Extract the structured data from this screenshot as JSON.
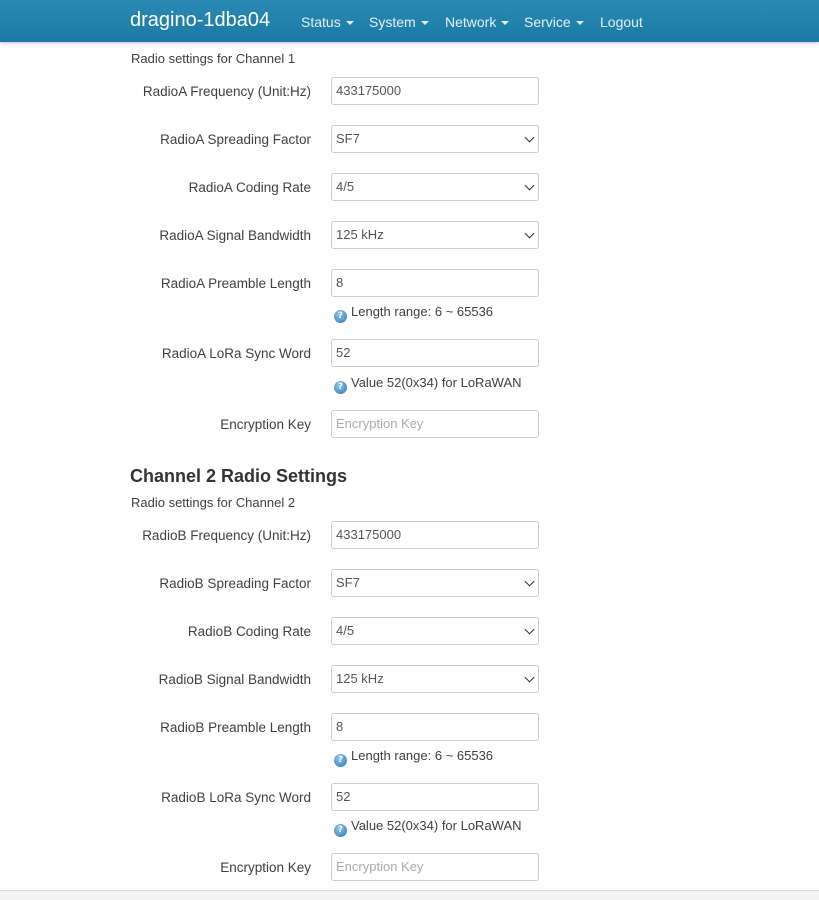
{
  "header": {
    "brand": "dragino-1dba04",
    "nav": [
      {
        "label": "Status"
      },
      {
        "label": "System"
      },
      {
        "label": "Network"
      },
      {
        "label": "Service"
      },
      {
        "label": "Logout"
      }
    ]
  },
  "channel1": {
    "description": "Radio settings for Channel 1",
    "frequency": {
      "label": "RadioA Frequency (Unit:Hz)",
      "value": "433175000"
    },
    "spreading_factor": {
      "label": "RadioA Spreading Factor",
      "value": "SF7"
    },
    "coding_rate": {
      "label": "RadioA Coding Rate",
      "value": "4/5"
    },
    "bandwidth": {
      "label": "RadioA Signal Bandwidth",
      "value": "125 kHz"
    },
    "preamble": {
      "label": "RadioA Preamble Length",
      "value": "8",
      "hint": "Length range: 6 ~ 65536"
    },
    "sync_word": {
      "label": "RadioA LoRa Sync Word",
      "value": "52",
      "hint": "Value 52(0x34) for LoRaWAN"
    },
    "encryption": {
      "label": "Encryption Key",
      "placeholder": "Encryption Key"
    }
  },
  "channel2": {
    "title": "Channel 2 Radio Settings",
    "description": "Radio settings for Channel 2",
    "frequency": {
      "label": "RadioB Frequency (Unit:Hz)",
      "value": "433175000"
    },
    "spreading_factor": {
      "label": "RadioB Spreading Factor",
      "value": "SF7"
    },
    "coding_rate": {
      "label": "RadioB Coding Rate",
      "value": "4/5"
    },
    "bandwidth": {
      "label": "RadioB Signal Bandwidth",
      "value": "125 kHz"
    },
    "preamble": {
      "label": "RadioB Preamble Length",
      "value": "8",
      "hint": "Length range: 6 ~ 65536"
    },
    "sync_word": {
      "label": "RadioB LoRa Sync Word",
      "value": "52",
      "hint": "Value 52(0x34) for LoRaWAN"
    },
    "encryption": {
      "label": "Encryption Key",
      "placeholder": "Encryption Key"
    }
  },
  "icons": {
    "help": "help-icon",
    "dropdown": "chevron-down-icon",
    "nav_caret": "caret-down-icon"
  },
  "colors": {
    "navbar": "#1f80ab",
    "nav_text": "#e4eff5"
  }
}
